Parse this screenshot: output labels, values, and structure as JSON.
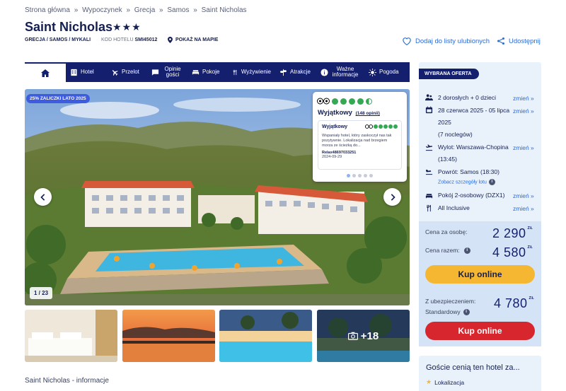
{
  "breadcrumb": [
    "Strona główna",
    "Wypoczynek",
    "Grecja",
    "Samos",
    "Saint Nicholas"
  ],
  "breadcrumb_separator": "»",
  "hotel": {
    "name": "Saint Nicholas",
    "stars": "★★★",
    "location": "GRECJA / SAMOS / MYKALI",
    "code_label": "KOD HOTELU",
    "code": "SMI45012",
    "map_link": "POKAŻ NA MAPIE"
  },
  "actions": {
    "favorite": "Dodaj do listy ulubionych",
    "share": "Udostępnij"
  },
  "nav": {
    "items": [
      {
        "label": "Hotel",
        "icon": "hotel-icon"
      },
      {
        "label": "Przelot",
        "icon": "plane-icon"
      },
      {
        "label": "Opinie gości",
        "icon": "chat-icon"
      },
      {
        "label": "Pokoje",
        "icon": "bed-icon"
      },
      {
        "label": "Wyżywienie",
        "icon": "cutlery-icon"
      },
      {
        "label": "Atrakcje",
        "icon": "signpost-icon"
      },
      {
        "label": "Ważne informacje",
        "icon": "info-icon"
      },
      {
        "label": "Pogoda",
        "icon": "sun-icon"
      }
    ]
  },
  "gallery": {
    "promo": "25% ZALICZKI LATO 2025",
    "counter": "1 / 23",
    "more_photos": "+18"
  },
  "tripadvisor": {
    "rating_label": "Wyjątkowy",
    "reviews_count": "(148 opinii)",
    "rating": 4.5,
    "review": {
      "title": "Wyjątkowy",
      "rating": 5,
      "text": "Wspaniały hotel, który zaskoczył nas tak pozytywnie. Lokalizacja nad brzegiem morza ze ścieżką do...",
      "author": "Relax48697033251",
      "date": "2024-09-29"
    },
    "pager_active": 0,
    "pager_count": 5
  },
  "info_heading": "Saint Nicholas - informacje",
  "offer": {
    "tag": "WYBRANA OFERTA",
    "change": "zmień »",
    "guests": "2 dorosłych + 0 dzieci",
    "dates": "28 czerwca 2025 - 05 lipca 2025",
    "dates_line1": "28 czerwca 2025 - 05 lipca",
    "dates_line2": "2025",
    "nights": "(7 noclegów)",
    "departure": "Wylot: Warszawa-Chopina",
    "departure_time": "(13:45)",
    "return": "Powrót: Samos (18:30)",
    "flight_details": "Zobacz szczegóły lotu",
    "room": "Pokój 2-osobowy (DZX1)",
    "board": "All Inclusive",
    "price_per_person_label": "Cena za osobę:",
    "price_per_person": "2 290",
    "price_total_label": "Cena razem:",
    "price_total": "4 580",
    "currency": "ZŁ",
    "buy_label": "Kup online",
    "insurance_label_1": "Z ubezpieczeniem:",
    "insurance_label_2": "Standardowy",
    "price_insured": "4 780"
  },
  "guests_card": {
    "title": "Goście cenią ten hotel za...",
    "item": "Lokalizacja"
  },
  "colors": {
    "navy": "#141f6e",
    "yellow": "#f5b731",
    "red": "#d7262d",
    "link": "#2b6bd6",
    "panel": "#e9f2fb"
  }
}
